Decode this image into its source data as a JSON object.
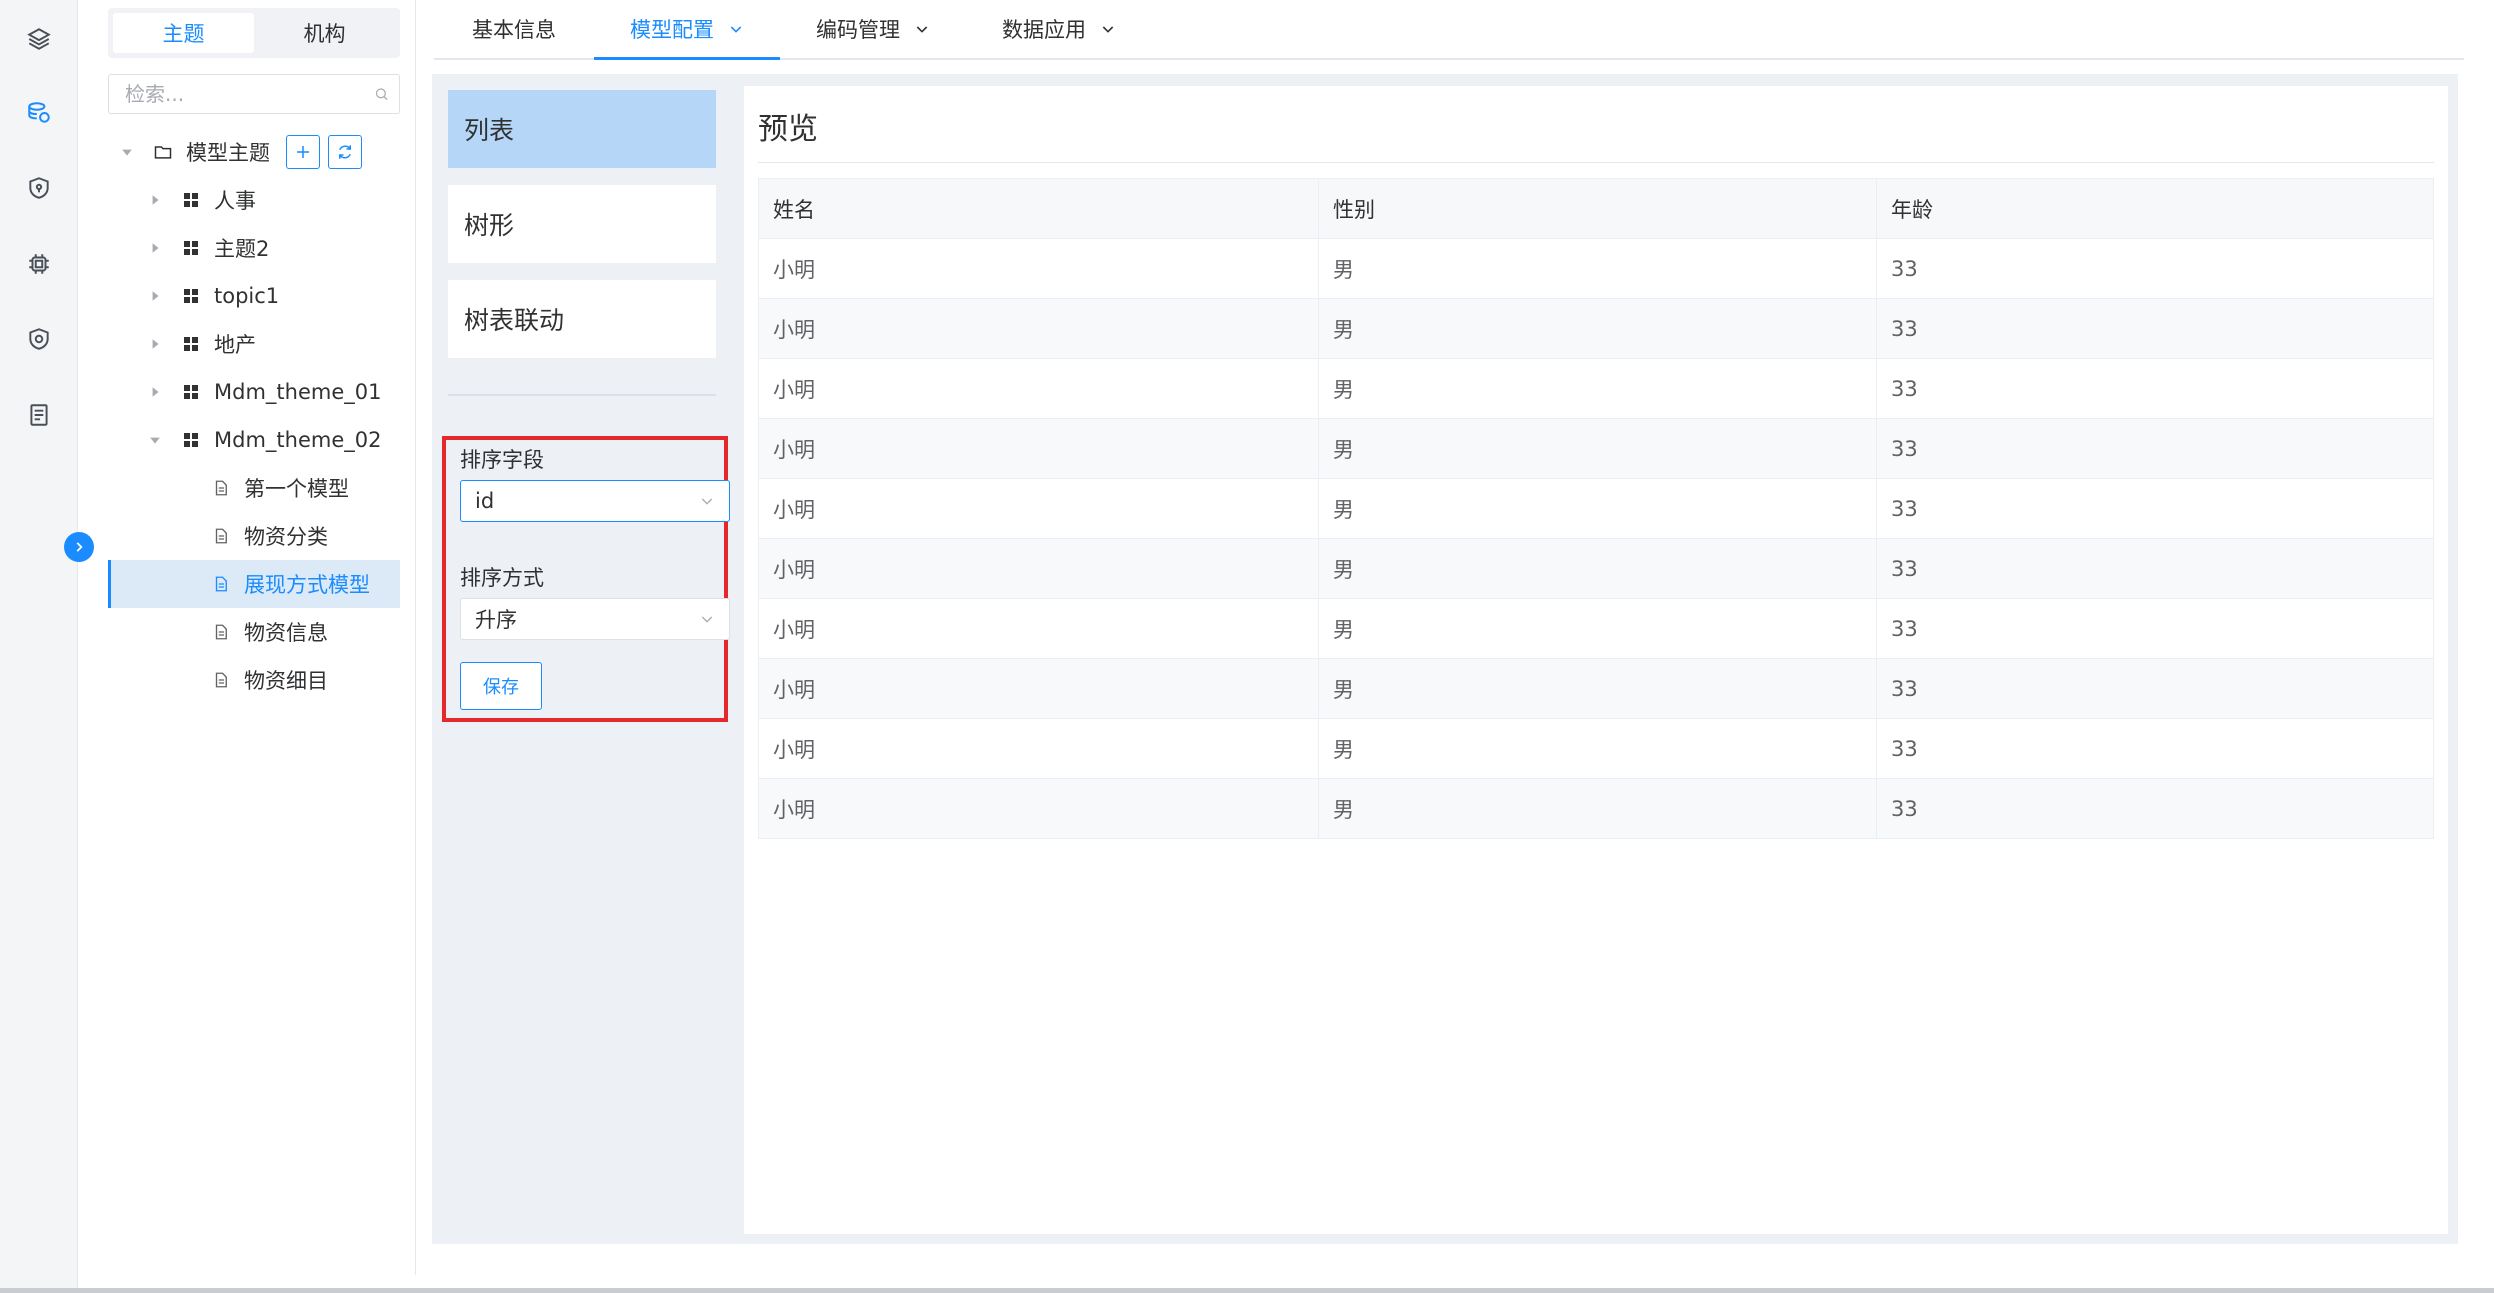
{
  "colors": {
    "accent": "#1a8cff",
    "highlight_border": "#e5282c",
    "selected_bg": "#dce9f7",
    "active_type_bg": "#b5d6f7"
  },
  "rail": {
    "icons": [
      "layers-icon",
      "database-icon",
      "shield-icon",
      "chip-icon",
      "security-icon",
      "document-icon"
    ]
  },
  "sidebar": {
    "segments": [
      "主题",
      "机构"
    ],
    "active_segment": 0,
    "search_placeholder": "检索...",
    "root": {
      "label": "模型主题",
      "add_icon": "plus-icon",
      "refresh_icon": "refresh-icon"
    },
    "themes": [
      "人事",
      "主题2",
      "topic1",
      "地产",
      "Mdm_theme_01",
      "Mdm_theme_02"
    ],
    "models": [
      "第一个模型",
      "物资分类",
      "展现方式模型",
      "物资信息",
      "物资细目"
    ],
    "selected_model": "展现方式模型"
  },
  "tabs": [
    {
      "label": "基本信息",
      "dropdown": false
    },
    {
      "label": "模型配置",
      "dropdown": true,
      "active": true
    },
    {
      "label": "编码管理",
      "dropdown": true
    },
    {
      "label": "数据应用",
      "dropdown": true
    }
  ],
  "display_types": [
    "列表",
    "树形",
    "树表联动"
  ],
  "active_display_type": "列表",
  "sort": {
    "field_label": "排序字段",
    "field_value": "id",
    "order_label": "排序方式",
    "order_value": "升序",
    "save_label": "保存"
  },
  "preview": {
    "title": "预览",
    "columns": [
      "姓名",
      "性别",
      "年龄"
    ],
    "rows": [
      [
        "小明",
        "男",
        "33"
      ],
      [
        "小明",
        "男",
        "33"
      ],
      [
        "小明",
        "男",
        "33"
      ],
      [
        "小明",
        "男",
        "33"
      ],
      [
        "小明",
        "男",
        "33"
      ],
      [
        "小明",
        "男",
        "33"
      ],
      [
        "小明",
        "男",
        "33"
      ],
      [
        "小明",
        "男",
        "33"
      ],
      [
        "小明",
        "男",
        "33"
      ],
      [
        "小明",
        "男",
        "33"
      ]
    ]
  }
}
